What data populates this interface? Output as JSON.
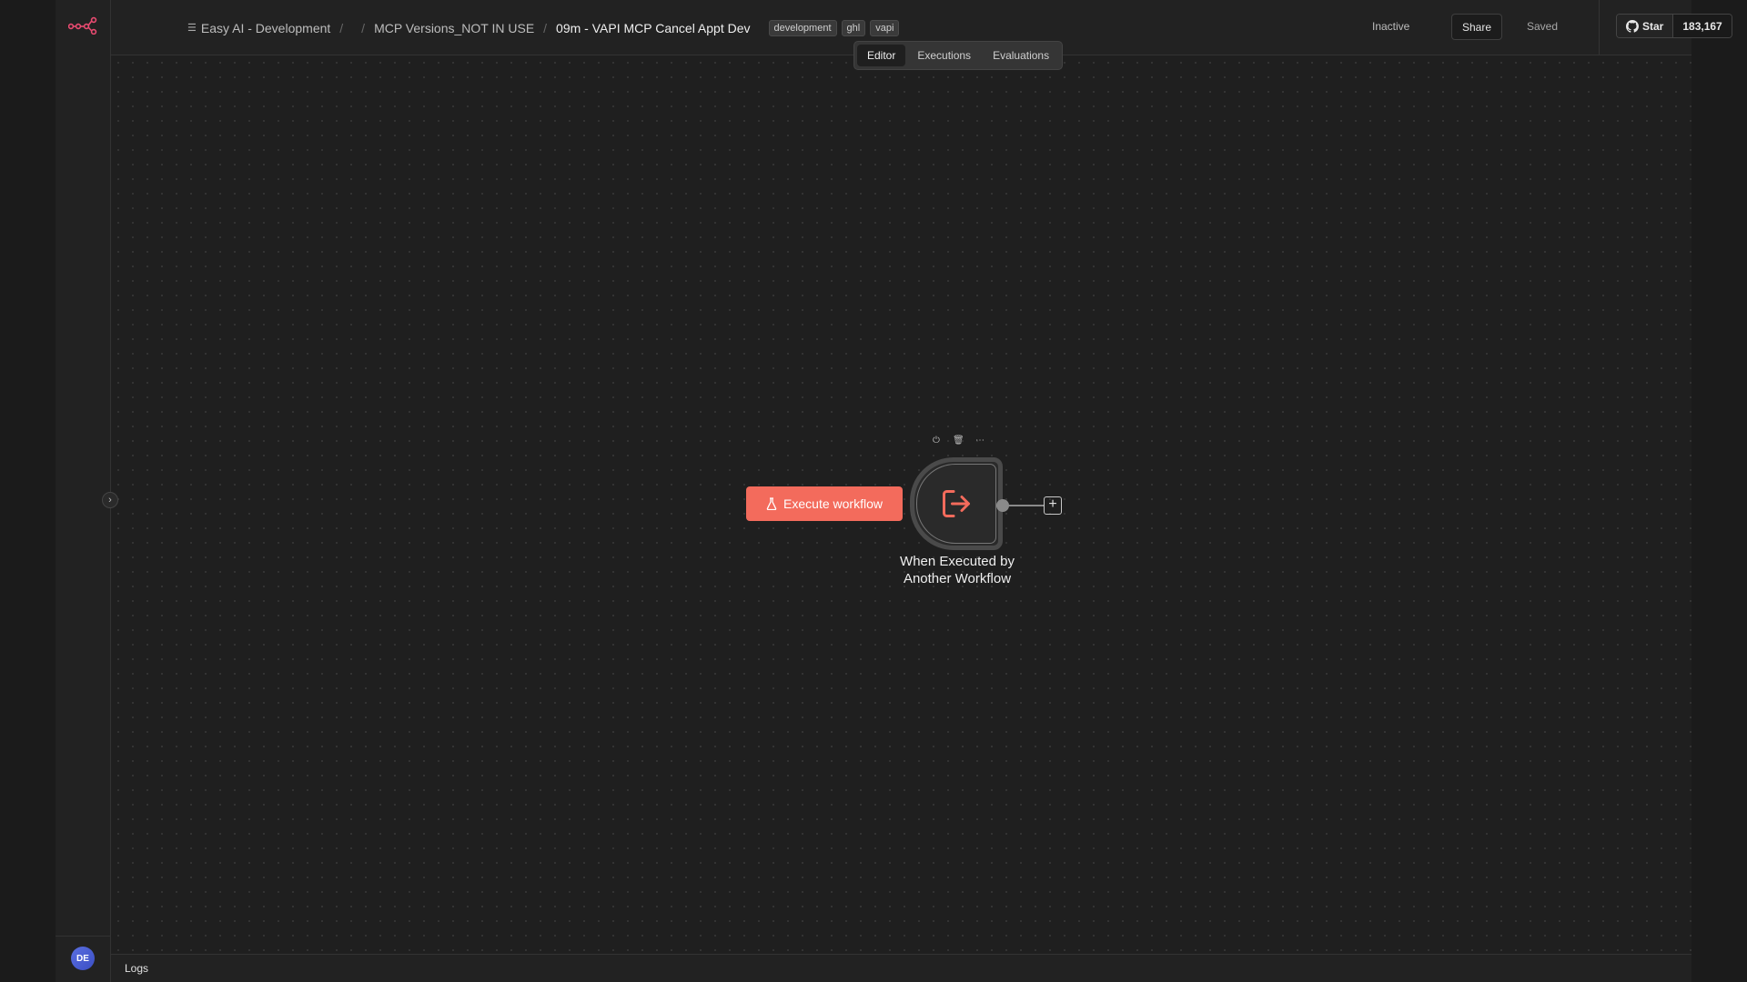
{
  "header": {
    "project": "Easy AI - Development",
    "folder_empty": "",
    "folder": "MCP Versions_NOT IN USE",
    "workflow_title": "09m - VAPI MCP Cancel Appt Dev",
    "tags": [
      "development",
      "ghl",
      "vapi"
    ],
    "status": "Inactive",
    "share_label": "Share",
    "saved_label": "Saved",
    "github": {
      "star_label": "Star",
      "count": "183,167"
    }
  },
  "tabs": [
    {
      "label": "Editor",
      "active": true
    },
    {
      "label": "Executions",
      "active": false
    },
    {
      "label": "Evaluations",
      "active": false
    }
  ],
  "canvas": {
    "execute_button_label": "Execute workflow",
    "node": {
      "label_line1": "When Executed by",
      "label_line2": "Another Workflow",
      "icon": "exit-arrow-icon",
      "accent_color": "#f36b5c"
    },
    "toolbar_icons": [
      "power-icon",
      "trash-icon",
      "more-icon"
    ]
  },
  "sidebar": {
    "avatar_initials": "DE",
    "logo_color": "#ea4b71"
  },
  "footer": {
    "logs_label": "Logs"
  },
  "colors": {
    "accent": "#f36b5c",
    "background": "#1f1f1f",
    "brand": "#ea4b71"
  }
}
